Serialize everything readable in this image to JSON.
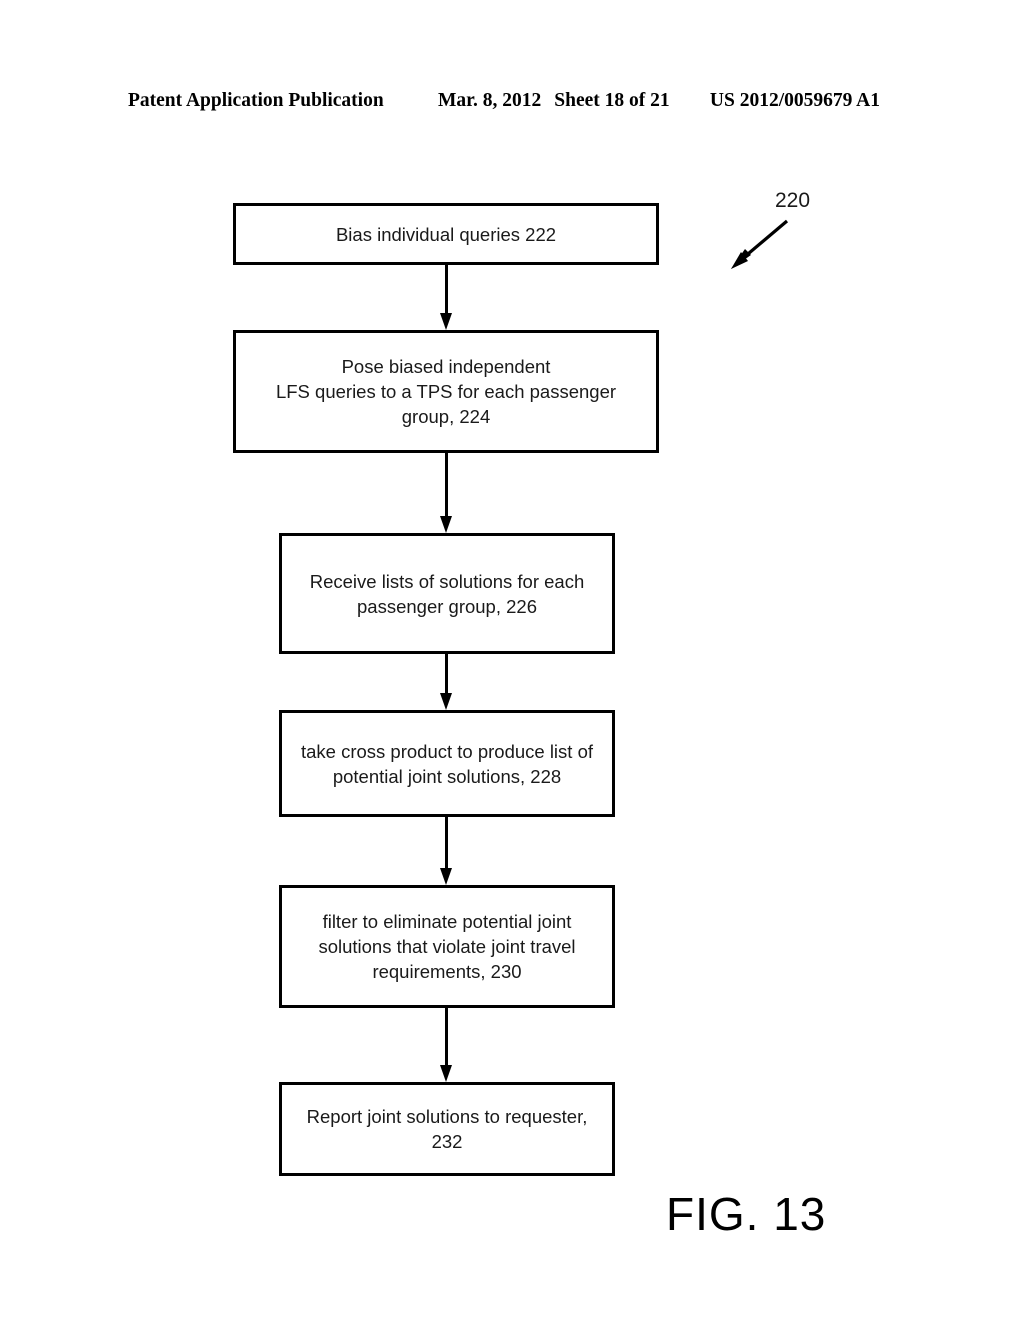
{
  "header": {
    "publication": "Patent Application Publication",
    "date": "Mar. 8, 2012",
    "sheet": "Sheet 18 of 21",
    "publication_number": "US 2012/0059679 A1"
  },
  "figure": {
    "caption": "FIG. 13",
    "reference_numeral": "220"
  },
  "flowchart": {
    "boxes": [
      {
        "id": "222",
        "text": "Bias individual queries 222"
      },
      {
        "id": "224",
        "text": "Pose biased independent\nLFS queries to a TPS for each passenger\ngroup, 224"
      },
      {
        "id": "226",
        "text": "Receive lists of solutions for each\npassenger group, 226"
      },
      {
        "id": "228",
        "text": "take cross product to produce list of\npotential joint solutions, 228"
      },
      {
        "id": "230",
        "text": "filter to eliminate potential joint\nsolutions that violate joint travel\nrequirements, 230"
      },
      {
        "id": "232",
        "text": "Report joint solutions to requester,\n232"
      }
    ],
    "connectors": [
      {
        "from": "222",
        "to": "224"
      },
      {
        "from": "224",
        "to": "226"
      },
      {
        "from": "226",
        "to": "228"
      },
      {
        "from": "228",
        "to": "230"
      },
      {
        "from": "230",
        "to": "232"
      }
    ]
  },
  "colors": {
    "ink": "#000000",
    "text": "#1a1a1a",
    "page_background": "#ffffff"
  }
}
